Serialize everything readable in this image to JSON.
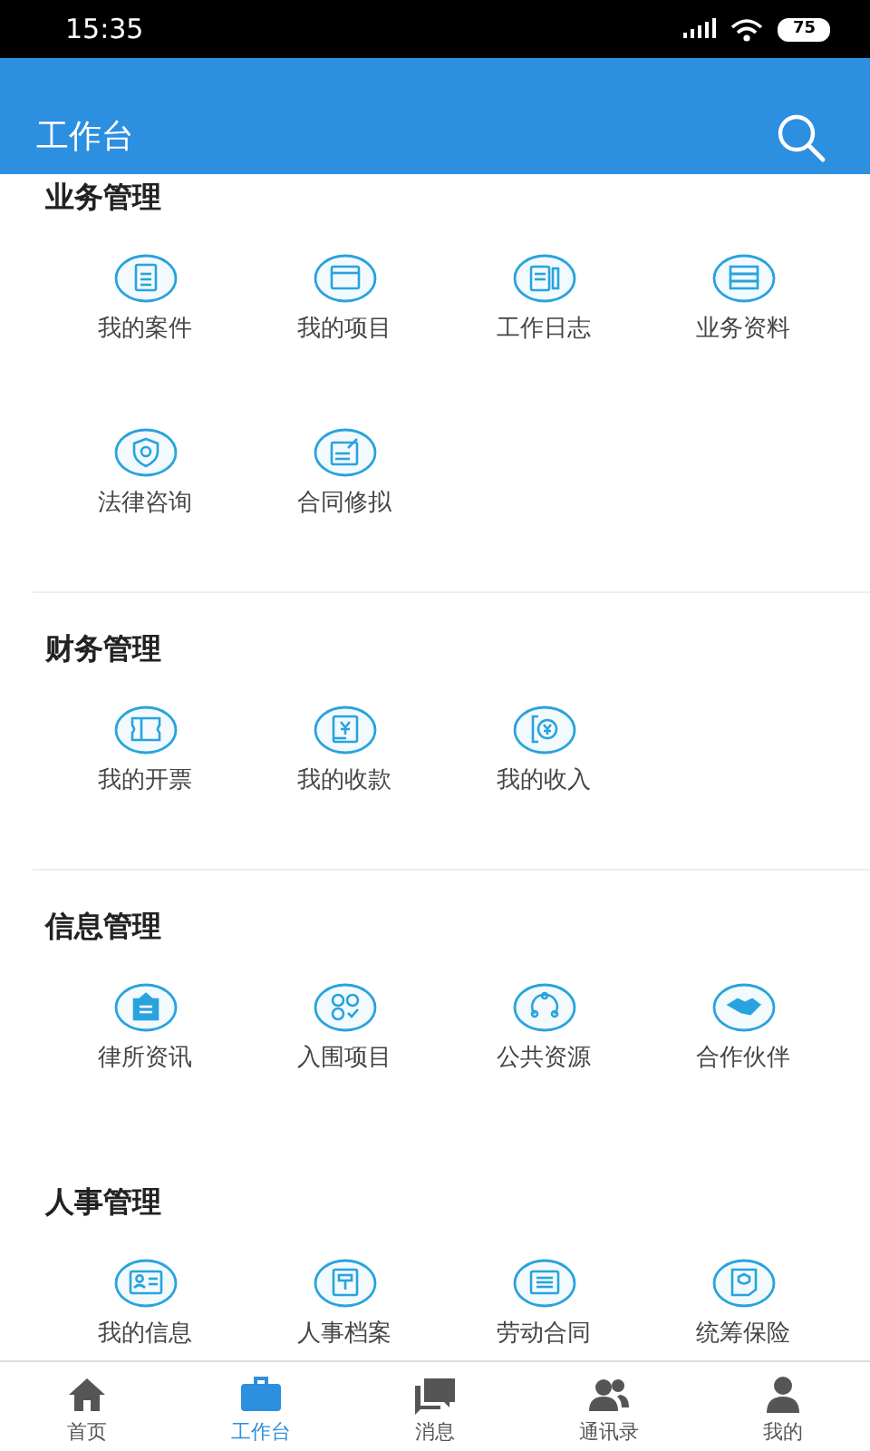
{
  "status_bar": {
    "time": "15:35",
    "battery": "75"
  },
  "header": {
    "title": "工作台"
  },
  "sections": [
    {
      "title": "业务管理",
      "divider_below": true,
      "items": [
        {
          "label": "我的案件"
        },
        {
          "label": "我的项目"
        },
        {
          "label": "工作日志"
        },
        {
          "label": "业务资料"
        },
        {
          "label": "法律咨询"
        },
        {
          "label": "合同修拟"
        }
      ]
    },
    {
      "title": "财务管理",
      "divider_below": true,
      "items": [
        {
          "label": "我的开票"
        },
        {
          "label": "我的收款"
        },
        {
          "label": "我的收入"
        }
      ]
    },
    {
      "title": "信息管理",
      "divider_below": false,
      "items": [
        {
          "label": "律所资讯"
        },
        {
          "label": "入围项目"
        },
        {
          "label": "公共资源"
        },
        {
          "label": "合作伙伴"
        }
      ]
    },
    {
      "title": "人事管理",
      "divider_below": false,
      "items": [
        {
          "label": "我的信息"
        },
        {
          "label": "人事档案"
        },
        {
          "label": "劳动合同"
        },
        {
          "label": "统筹保险"
        }
      ]
    }
  ],
  "bottom_nav": [
    {
      "label": "首页",
      "selected": false
    },
    {
      "label": "工作台",
      "selected": true
    },
    {
      "label": "消息",
      "selected": false
    },
    {
      "label": "通讯录",
      "selected": false
    },
    {
      "label": "我的",
      "selected": false
    }
  ]
}
